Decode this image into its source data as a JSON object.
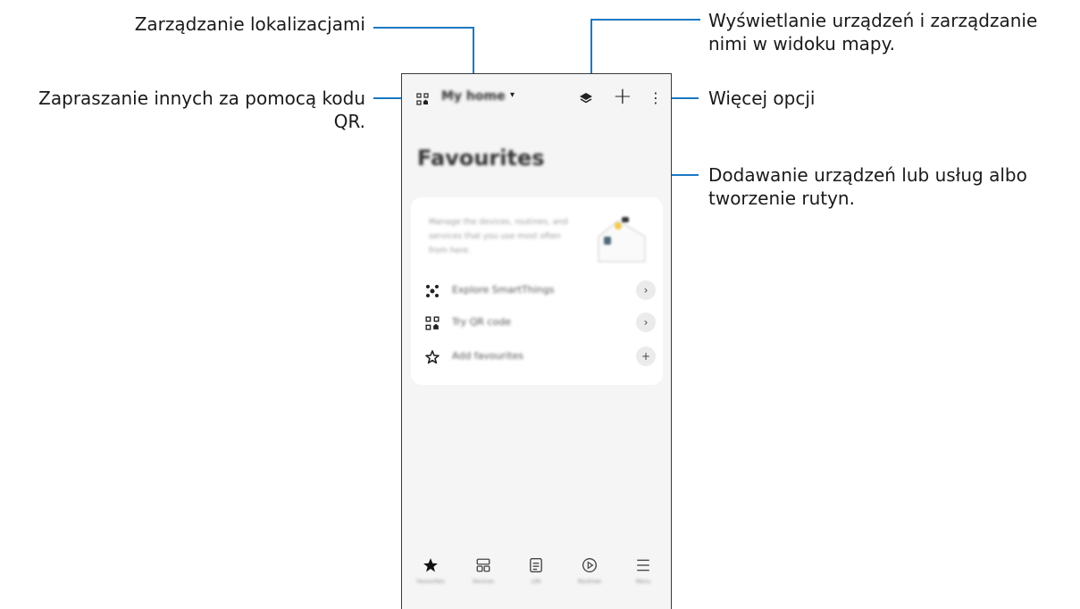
{
  "callouts": {
    "manage_locations": "Zarządzanie lokalizacjami",
    "invite_qr_line1": "Zapraszanie innych za pomocą kodu",
    "invite_qr_line2": "QR.",
    "map_view_line1": "Wyświetlanie urządzeń i zarządzanie",
    "map_view_line2": "nimi w widoku mapy.",
    "more_options": "Więcej opcji",
    "add_line1": "Dodawanie urządzeń lub usług albo",
    "add_line2": "tworzenie rutyn."
  },
  "topbar": {
    "location": "My home",
    "caret": "▾",
    "add": "+",
    "more": "⋮"
  },
  "page_title": "Favourites",
  "card": {
    "description": "Manage the devices, routines, and services that you use most often from here.",
    "rows": [
      {
        "label": "Explore SmartThings",
        "icon": "smartthings-icon",
        "action": "›"
      },
      {
        "label": "Try QR code",
        "icon": "qr-code-icon",
        "action": "›"
      },
      {
        "label": "Add favourites",
        "icon": "star-outline-icon",
        "action": "+"
      }
    ]
  },
  "bottom_nav": [
    {
      "label": "Favourites",
      "icon": "star-filled-icon"
    },
    {
      "label": "Devices",
      "icon": "devices-icon"
    },
    {
      "label": "Life",
      "icon": "life-icon"
    },
    {
      "label": "Routines",
      "icon": "routines-icon"
    },
    {
      "label": "Menu",
      "icon": "menu-icon"
    }
  ],
  "colors": {
    "leader_line": "#1b78c2",
    "screen_bg": "#f5f5f5",
    "card_bg": "#ffffff"
  }
}
